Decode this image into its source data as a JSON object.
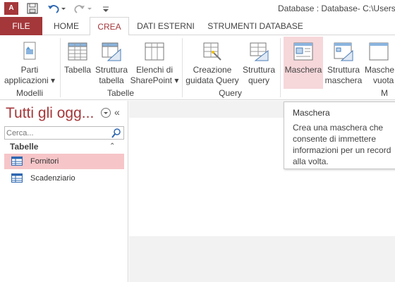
{
  "titlebar": {
    "app_badge": "A",
    "title": "Database : Database- C:\\Users\\"
  },
  "tabs": [
    {
      "label": "FILE"
    },
    {
      "label": "HOME"
    },
    {
      "label": "CREA"
    },
    {
      "label": "DATI ESTERNI"
    },
    {
      "label": "STRUMENTI DATABASE"
    }
  ],
  "ribbon": {
    "buttons": [
      {
        "line1": "Parti",
        "line2": "applicazioni ▾",
        "icon": "parts-icon"
      },
      {
        "line1": "Tabella",
        "line2": "",
        "icon": "table-icon"
      },
      {
        "line1": "Struttura",
        "line2": "tabella",
        "icon": "table-design-icon"
      },
      {
        "line1": "Elenchi di",
        "line2": "SharePoint ▾",
        "icon": "sharepoint-list-icon"
      },
      {
        "line1": "Creazione",
        "line2": "guidata Query",
        "icon": "query-wizard-icon"
      },
      {
        "line1": "Struttura",
        "line2": "query",
        "icon": "query-design-icon"
      },
      {
        "line1": "Maschera",
        "line2": "",
        "icon": "form-icon"
      },
      {
        "line1": "Struttura",
        "line2": "maschera",
        "icon": "form-design-icon"
      },
      {
        "line1": "Masche",
        "line2": "vuota",
        "icon": "blank-form-icon"
      }
    ],
    "groups": [
      "Modelli",
      "Tabelle",
      "Query",
      "M"
    ]
  },
  "nav": {
    "title": "Tutti gli ogg...",
    "search_placeholder": "Cerca...",
    "section": "Tabelle",
    "items": [
      {
        "label": "Fornitori",
        "selected": true
      },
      {
        "label": "Scadenziario",
        "selected": false
      }
    ]
  },
  "tooltip": {
    "title": "Maschera",
    "body": "Crea una maschera che consente di immettere informazioni per un record alla volta."
  },
  "colors": {
    "accent": "#a4373a",
    "highlight": "#f6d7da",
    "selected_row": "#f6c5c8"
  }
}
